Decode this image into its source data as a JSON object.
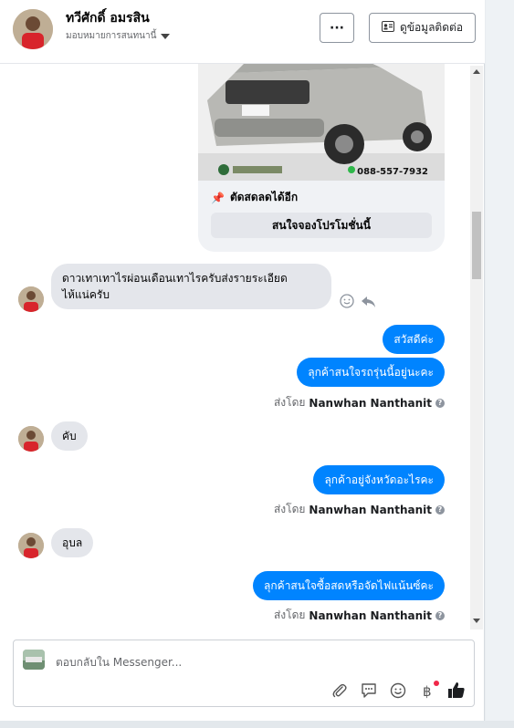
{
  "header": {
    "name": "ทวีศักดิ์ อมรสิน",
    "assign_label": "มอบหมายการสนทนานี้",
    "more_label": "···",
    "contact_label": "ดูข้อมูลติดต่อ"
  },
  "card": {
    "phone": "088-557-7932",
    "title": "ตัดสดลดได้อีก",
    "button": "สนใจจองโปรโมชั่นนี้"
  },
  "messages": [
    {
      "from": "customer",
      "text_line1": "ดาวเทาเทาไรผ่อนเดือนเทาไรครับส่งรายระเอียด",
      "text_line2": "ไห้แน่ครับ"
    },
    {
      "from": "page",
      "text": "สวัสดีค่ะ"
    },
    {
      "from": "page",
      "text": "ลุกค้าสนใจรถรุ่นนี้อยู่นะคะ"
    },
    {
      "from": "customer",
      "text": "คับ"
    },
    {
      "from": "page",
      "text": "ลุกค้าอยู่จังหวัดอะไรคะ"
    },
    {
      "from": "customer",
      "text": "อุบล"
    },
    {
      "from": "page",
      "text": "ลุกค้าสนใจซื้อสดหรือจัดไฟแน้นซ์คะ"
    }
  ],
  "sent_by": {
    "prefix": "ส่งโดย",
    "agent": "Nanwhan Nanthanit",
    "help": "?"
  },
  "composer": {
    "placeholder": "ตอบกลับใน Messenger..."
  },
  "colors": {
    "accent": "#0084ff",
    "bubble_in": "#e4e6eb",
    "like_icon": "#1c1e21"
  },
  "icons": [
    "more-icon",
    "contact-card-icon",
    "pin-icon",
    "emoji-react-icon",
    "reply-icon",
    "help-icon",
    "attachment-icon",
    "saved-reply-icon",
    "emoji-icon",
    "payment-icon",
    "like-icon"
  ]
}
